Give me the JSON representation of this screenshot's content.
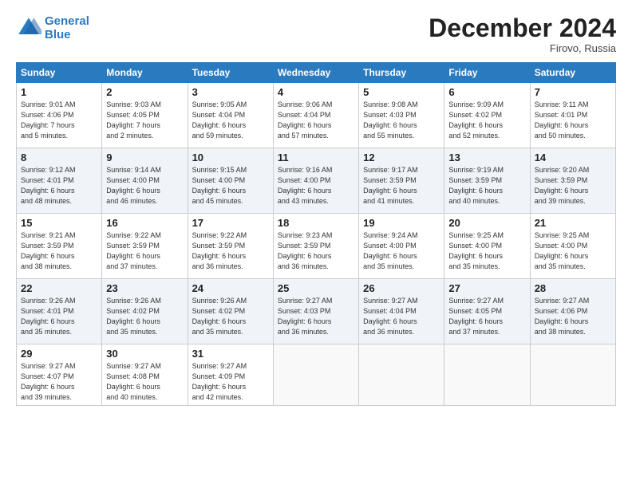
{
  "header": {
    "logo_line1": "General",
    "logo_line2": "Blue",
    "month": "December 2024",
    "location": "Firovo, Russia"
  },
  "weekdays": [
    "Sunday",
    "Monday",
    "Tuesday",
    "Wednesday",
    "Thursday",
    "Friday",
    "Saturday"
  ],
  "weeks": [
    [
      {
        "day": "1",
        "info": "Sunrise: 9:01 AM\nSunset: 4:06 PM\nDaylight: 7 hours\nand 5 minutes."
      },
      {
        "day": "2",
        "info": "Sunrise: 9:03 AM\nSunset: 4:05 PM\nDaylight: 7 hours\nand 2 minutes."
      },
      {
        "day": "3",
        "info": "Sunrise: 9:05 AM\nSunset: 4:04 PM\nDaylight: 6 hours\nand 59 minutes."
      },
      {
        "day": "4",
        "info": "Sunrise: 9:06 AM\nSunset: 4:04 PM\nDaylight: 6 hours\nand 57 minutes."
      },
      {
        "day": "5",
        "info": "Sunrise: 9:08 AM\nSunset: 4:03 PM\nDaylight: 6 hours\nand 55 minutes."
      },
      {
        "day": "6",
        "info": "Sunrise: 9:09 AM\nSunset: 4:02 PM\nDaylight: 6 hours\nand 52 minutes."
      },
      {
        "day": "7",
        "info": "Sunrise: 9:11 AM\nSunset: 4:01 PM\nDaylight: 6 hours\nand 50 minutes."
      }
    ],
    [
      {
        "day": "8",
        "info": "Sunrise: 9:12 AM\nSunset: 4:01 PM\nDaylight: 6 hours\nand 48 minutes."
      },
      {
        "day": "9",
        "info": "Sunrise: 9:14 AM\nSunset: 4:00 PM\nDaylight: 6 hours\nand 46 minutes."
      },
      {
        "day": "10",
        "info": "Sunrise: 9:15 AM\nSunset: 4:00 PM\nDaylight: 6 hours\nand 45 minutes."
      },
      {
        "day": "11",
        "info": "Sunrise: 9:16 AM\nSunset: 4:00 PM\nDaylight: 6 hours\nand 43 minutes."
      },
      {
        "day": "12",
        "info": "Sunrise: 9:17 AM\nSunset: 3:59 PM\nDaylight: 6 hours\nand 41 minutes."
      },
      {
        "day": "13",
        "info": "Sunrise: 9:19 AM\nSunset: 3:59 PM\nDaylight: 6 hours\nand 40 minutes."
      },
      {
        "day": "14",
        "info": "Sunrise: 9:20 AM\nSunset: 3:59 PM\nDaylight: 6 hours\nand 39 minutes."
      }
    ],
    [
      {
        "day": "15",
        "info": "Sunrise: 9:21 AM\nSunset: 3:59 PM\nDaylight: 6 hours\nand 38 minutes."
      },
      {
        "day": "16",
        "info": "Sunrise: 9:22 AM\nSunset: 3:59 PM\nDaylight: 6 hours\nand 37 minutes."
      },
      {
        "day": "17",
        "info": "Sunrise: 9:22 AM\nSunset: 3:59 PM\nDaylight: 6 hours\nand 36 minutes."
      },
      {
        "day": "18",
        "info": "Sunrise: 9:23 AM\nSunset: 3:59 PM\nDaylight: 6 hours\nand 36 minutes."
      },
      {
        "day": "19",
        "info": "Sunrise: 9:24 AM\nSunset: 4:00 PM\nDaylight: 6 hours\nand 35 minutes."
      },
      {
        "day": "20",
        "info": "Sunrise: 9:25 AM\nSunset: 4:00 PM\nDaylight: 6 hours\nand 35 minutes."
      },
      {
        "day": "21",
        "info": "Sunrise: 9:25 AM\nSunset: 4:00 PM\nDaylight: 6 hours\nand 35 minutes."
      }
    ],
    [
      {
        "day": "22",
        "info": "Sunrise: 9:26 AM\nSunset: 4:01 PM\nDaylight: 6 hours\nand 35 minutes."
      },
      {
        "day": "23",
        "info": "Sunrise: 9:26 AM\nSunset: 4:02 PM\nDaylight: 6 hours\nand 35 minutes."
      },
      {
        "day": "24",
        "info": "Sunrise: 9:26 AM\nSunset: 4:02 PM\nDaylight: 6 hours\nand 35 minutes."
      },
      {
        "day": "25",
        "info": "Sunrise: 9:27 AM\nSunset: 4:03 PM\nDaylight: 6 hours\nand 36 minutes."
      },
      {
        "day": "26",
        "info": "Sunrise: 9:27 AM\nSunset: 4:04 PM\nDaylight: 6 hours\nand 36 minutes."
      },
      {
        "day": "27",
        "info": "Sunrise: 9:27 AM\nSunset: 4:05 PM\nDaylight: 6 hours\nand 37 minutes."
      },
      {
        "day": "28",
        "info": "Sunrise: 9:27 AM\nSunset: 4:06 PM\nDaylight: 6 hours\nand 38 minutes."
      }
    ],
    [
      {
        "day": "29",
        "info": "Sunrise: 9:27 AM\nSunset: 4:07 PM\nDaylight: 6 hours\nand 39 minutes."
      },
      {
        "day": "30",
        "info": "Sunrise: 9:27 AM\nSunset: 4:08 PM\nDaylight: 6 hours\nand 40 minutes."
      },
      {
        "day": "31",
        "info": "Sunrise: 9:27 AM\nSunset: 4:09 PM\nDaylight: 6 hours\nand 42 minutes."
      },
      {
        "day": "",
        "info": ""
      },
      {
        "day": "",
        "info": ""
      },
      {
        "day": "",
        "info": ""
      },
      {
        "day": "",
        "info": ""
      }
    ]
  ]
}
